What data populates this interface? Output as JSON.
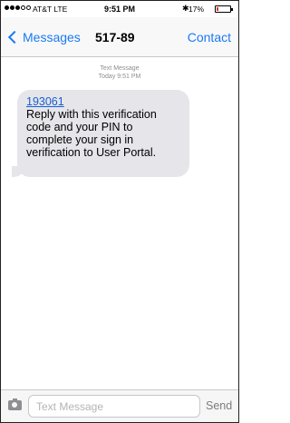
{
  "status_bar": {
    "carrier": "AT&T  LTE",
    "time": "9:51 PM",
    "bluetooth_icon": "bluetooth-icon",
    "battery_percent": "17%",
    "battery_level": 0.17,
    "battery_color": "#dd3322"
  },
  "nav": {
    "back_label": "Messages",
    "title": "517-89",
    "contact_label": "Contact"
  },
  "thread": {
    "meta_line1": "Text Message",
    "meta_line2": "Today 9:51 PM",
    "messages": [
      {
        "code": "193061",
        "body": "Reply with this verification code and your PIN to complete your sign in verification to User Portal."
      }
    ]
  },
  "input_bar": {
    "camera_icon": "camera-icon",
    "placeholder": "Text Message",
    "send_label": "Send"
  },
  "colors": {
    "accent": "#1a7af3",
    "bubble": "#e5e5ea",
    "link": "#1a5fd0"
  }
}
